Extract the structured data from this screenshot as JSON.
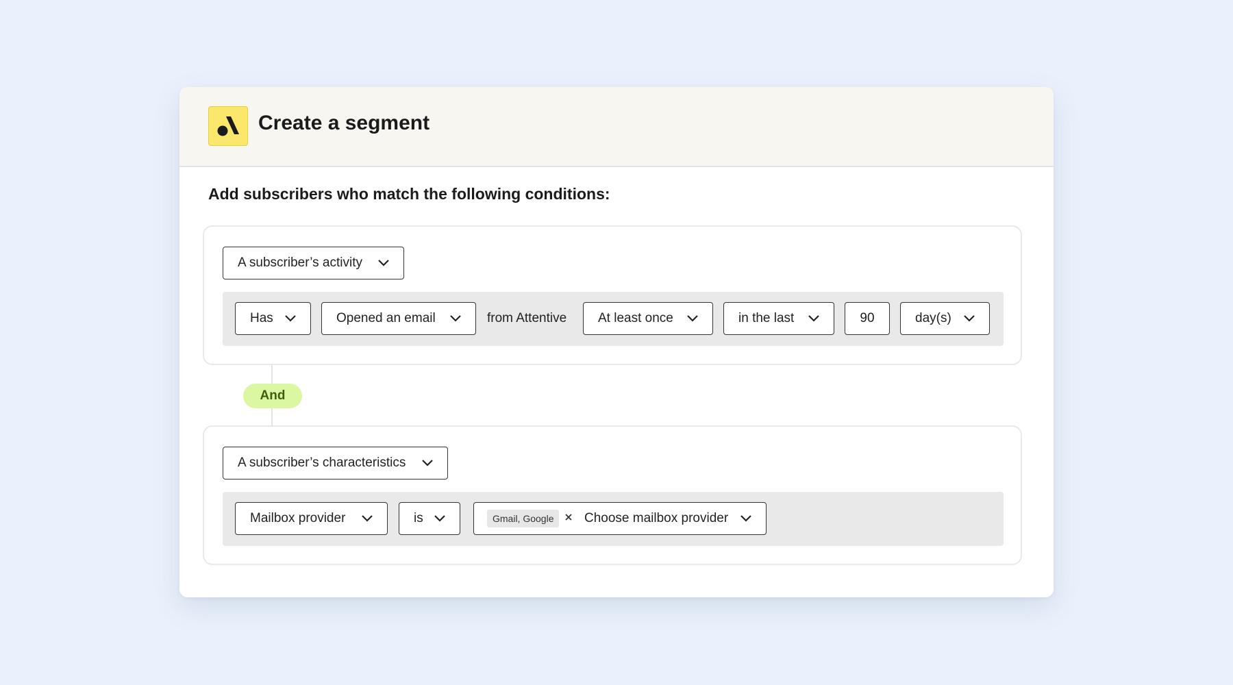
{
  "header": {
    "title": "Create a segment",
    "logo_icon": "attentive-logo-icon",
    "logo_color": "#fbe76b"
  },
  "subtitle": "Add subscribers who match the following conditions:",
  "group1": {
    "type_select": "A subscriber’s activity",
    "condition": {
      "has_select": "Has",
      "event_select": "Opened an email",
      "source_text": "from Attentive",
      "frequency_select": "At least once",
      "time_select": "in the last",
      "amount_value": "90",
      "unit_select": "day(s)"
    }
  },
  "connector": {
    "label": "And",
    "color": "#dcf7a2"
  },
  "group2": {
    "type_select": "A subscriber’s characteristics",
    "condition": {
      "attribute_select": "Mailbox provider",
      "operator_select": "is",
      "selected_chip": "Gmail, Google",
      "value_placeholder": "Choose mailbox provider"
    }
  },
  "colors": {
    "background": "#eaf1fc",
    "header_bg": "#f8f6f1",
    "row_bg": "#e8e9e8"
  }
}
